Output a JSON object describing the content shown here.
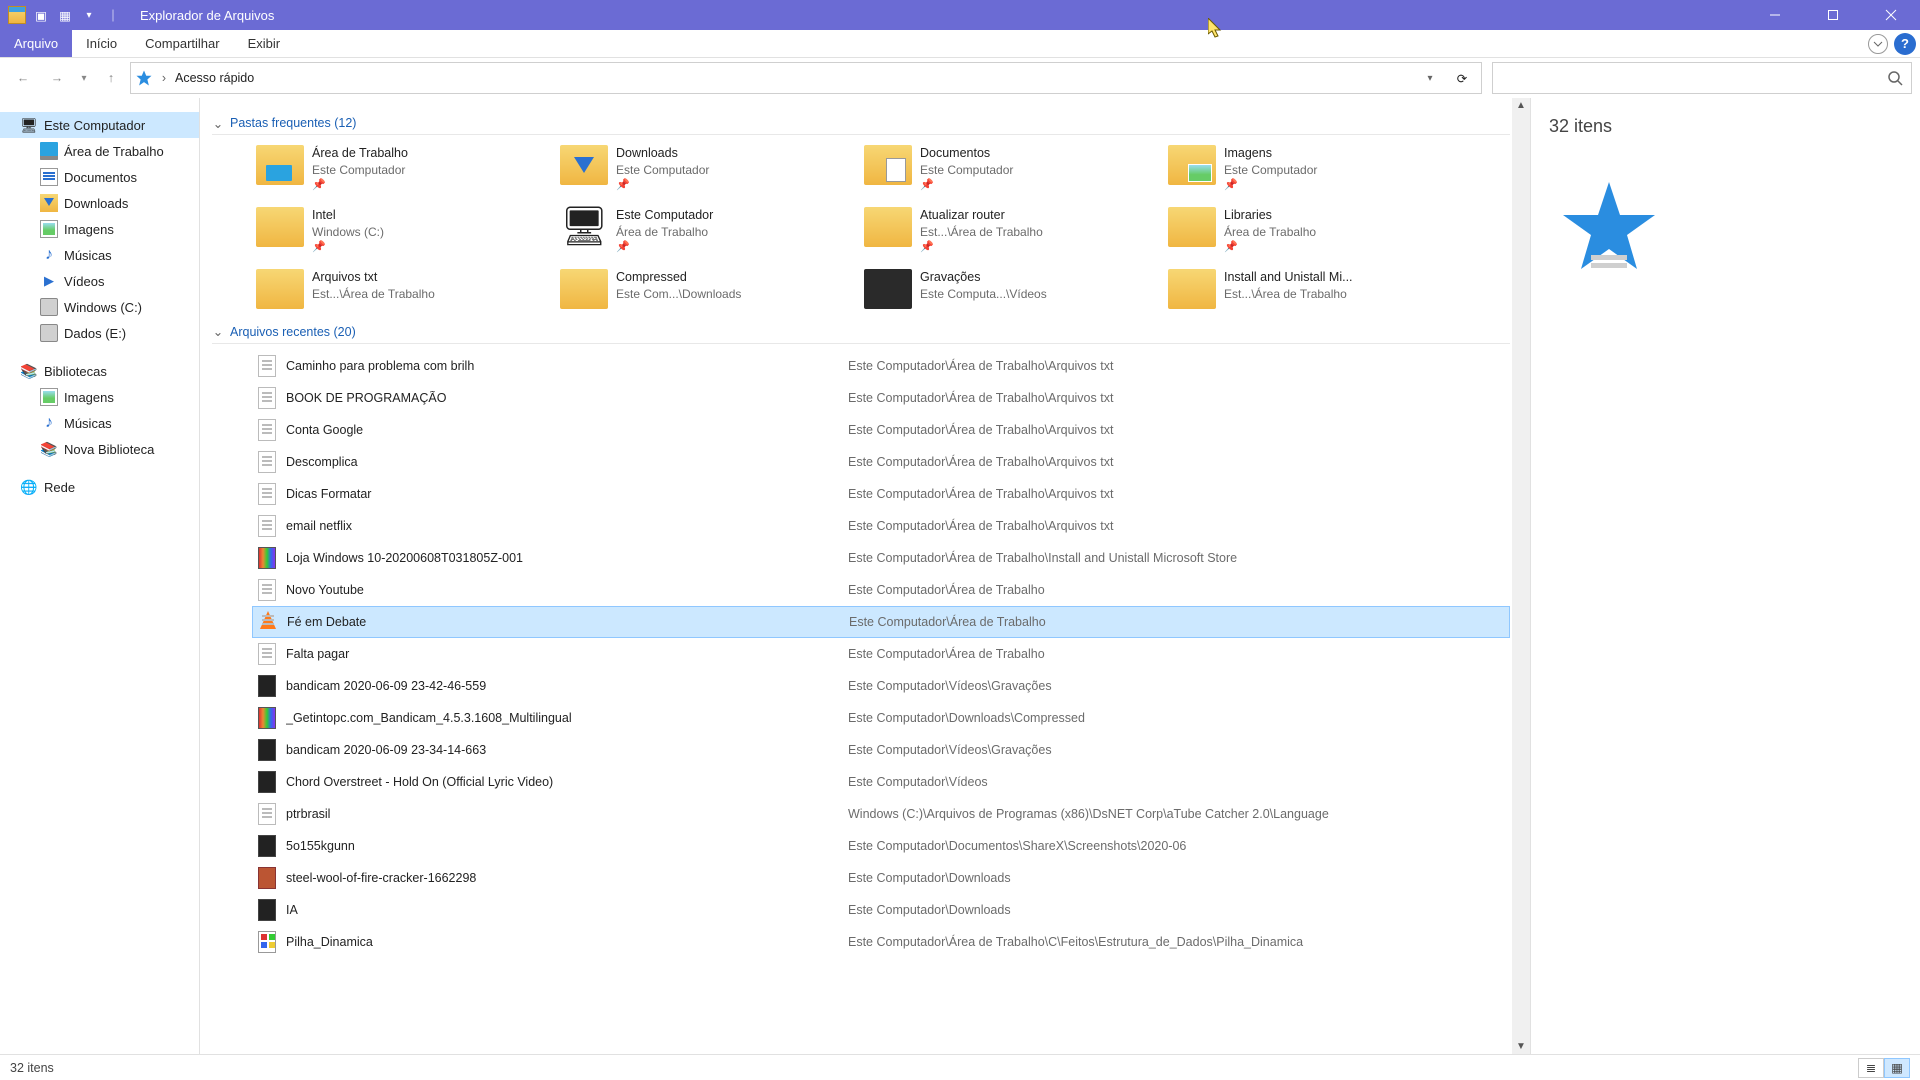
{
  "window": {
    "title": "Explorador de Arquivos",
    "item_count_label": "32 itens"
  },
  "menuTabs": {
    "arquivo": "Arquivo",
    "inicio": "Início",
    "compartilhar": "Compartilhar",
    "exibir": "Exibir"
  },
  "address": {
    "path": "Acesso rápido",
    "sep": "›"
  },
  "tree": {
    "thisPC": "Este Computador",
    "desktop": "Área de Trabalho",
    "documents": "Documentos",
    "downloads": "Downloads",
    "images": "Imagens",
    "music": "Músicas",
    "videos": "Vídeos",
    "driveC": "Windows (C:)",
    "driveE": "Dados (E:)",
    "libraries": "Bibliotecas",
    "libImages": "Imagens",
    "libMusic": "Músicas",
    "libNew": "Nova Biblioteca",
    "network": "Rede"
  },
  "groups": {
    "frequent": "Pastas frequentes (12)",
    "recent": "Arquivos recentes (20)"
  },
  "folders": [
    {
      "name": "Área de Trabalho",
      "sub": "Este Computador",
      "pin": true,
      "icon": "desktop"
    },
    {
      "name": "Downloads",
      "sub": "Este Computador",
      "pin": true,
      "icon": "down"
    },
    {
      "name": "Documentos",
      "sub": "Este Computador",
      "pin": true,
      "icon": "docs"
    },
    {
      "name": "Imagens",
      "sub": "Este Computador",
      "pin": true,
      "icon": "imgs"
    },
    {
      "name": "Intel",
      "sub": "Windows (C:)",
      "pin": true,
      "icon": "folder"
    },
    {
      "name": "Este Computador",
      "sub": "Área de Trabalho",
      "pin": true,
      "icon": "pc"
    },
    {
      "name": "Atualizar router",
      "sub": "Est...\\Área de Trabalho",
      "pin": true,
      "icon": "folder"
    },
    {
      "name": "Libraries",
      "sub": "Área de Trabalho",
      "pin": true,
      "icon": "folder"
    },
    {
      "name": "Arquivos txt",
      "sub": "Est...\\Área de Trabalho",
      "pin": false,
      "icon": "folder"
    },
    {
      "name": "Compressed",
      "sub": "Este Com...\\Downloads",
      "pin": false,
      "icon": "folder"
    },
    {
      "name": "Gravações",
      "sub": "Este Computa...\\Vídeos",
      "pin": false,
      "icon": "dark"
    },
    {
      "name": "Install and Unistall Mi...",
      "sub": "Est...\\Área de Trabalho",
      "pin": false,
      "icon": "folder"
    }
  ],
  "recent": [
    {
      "icon": "txt",
      "name": "Caminho para problema com brilh",
      "path": "Este Computador\\Área de Trabalho\\Arquivos txt"
    },
    {
      "icon": "txt",
      "name": "BOOK DE PROGRAMAÇÃO",
      "path": "Este Computador\\Área de Trabalho\\Arquivos txt"
    },
    {
      "icon": "txt",
      "name": "Conta Google",
      "path": "Este Computador\\Área de Trabalho\\Arquivos txt"
    },
    {
      "icon": "txt",
      "name": "Descomplica",
      "path": "Este Computador\\Área de Trabalho\\Arquivos txt"
    },
    {
      "icon": "txt",
      "name": "Dicas Formatar",
      "path": "Este Computador\\Área de Trabalho\\Arquivos txt"
    },
    {
      "icon": "txt",
      "name": "email netflix",
      "path": "Este Computador\\Área de Trabalho\\Arquivos txt"
    },
    {
      "icon": "rar",
      "name": "Loja Windows 10-20200608T031805Z-001",
      "path": "Este Computador\\Área de Trabalho\\Install and Unistall Microsoft Store"
    },
    {
      "icon": "txt",
      "name": "Novo Youtube",
      "path": "Este Computador\\Área de Trabalho"
    },
    {
      "icon": "vlc",
      "name": "Fé em Debate",
      "path": "Este Computador\\Área de Trabalho",
      "selected": true
    },
    {
      "icon": "txt",
      "name": "Falta pagar",
      "path": "Este Computador\\Área de Trabalho"
    },
    {
      "icon": "vid",
      "name": "bandicam 2020-06-09 23-42-46-559",
      "path": "Este Computador\\Vídeos\\Gravações"
    },
    {
      "icon": "rar",
      "name": "_Getintopc.com_Bandicam_4.5.3.1608_Multilingual",
      "path": "Este Computador\\Downloads\\Compressed"
    },
    {
      "icon": "vid",
      "name": "bandicam 2020-06-09 23-34-14-663",
      "path": "Este Computador\\Vídeos\\Gravações"
    },
    {
      "icon": "vid",
      "name": "Chord Overstreet - Hold On (Official Lyric Video)",
      "path": "Este Computador\\Vídeos"
    },
    {
      "icon": "txt",
      "name": "ptrbrasil",
      "path": "Windows (C:)\\Arquivos de Programas (x86)\\DsNET Corp\\aTube Catcher 2.0\\Language"
    },
    {
      "icon": "vid",
      "name": "5o155kgunn",
      "path": "Este Computador\\Documentos\\ShareX\\Screenshots\\2020-06"
    },
    {
      "icon": "png",
      "name": "steel-wool-of-fire-cracker-1662298",
      "path": "Este Computador\\Downloads"
    },
    {
      "icon": "vid",
      "name": "IA",
      "path": "Este Computador\\Downloads"
    },
    {
      "icon": "c",
      "name": "Pilha_Dinamica",
      "path": "Este Computador\\Área de Trabalho\\C\\Feitos\\Estrutura_de_Dados\\Pilha_Dinamica"
    }
  ],
  "preview": {
    "count": "32 itens"
  },
  "status": {
    "left": "32 itens"
  }
}
